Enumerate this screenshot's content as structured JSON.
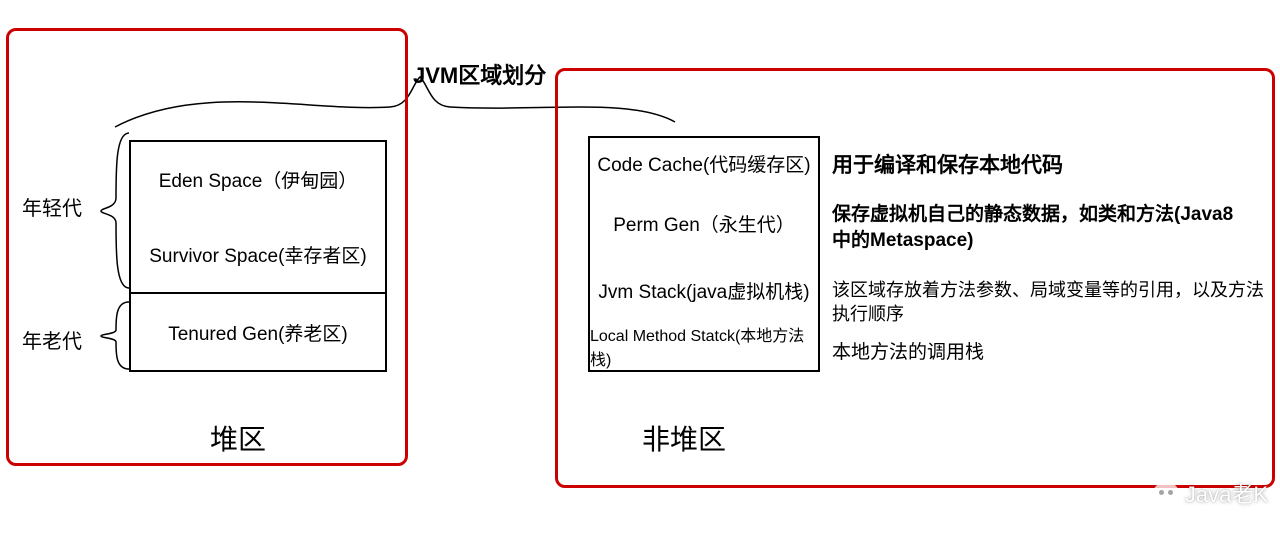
{
  "title": "JVM区域划分",
  "heap": {
    "young_label": "年轻代",
    "old_label": "年老代",
    "eden": "Eden Space（伊甸园）",
    "survivor": "Survivor Space(幸存者区)",
    "tenured": "Tenured Gen(养老区)",
    "caption": "堆区"
  },
  "nonheap": {
    "code_cache": "Code Cache(代码缓存区)",
    "perm_gen": "Perm Gen（永生代）",
    "jvm_stack": "Jvm Stack(java虚拟机栈)",
    "local_stack": "Local Method Statck(本地方法栈)",
    "caption": "非堆区"
  },
  "desc": {
    "d1": "用于编译和保存本地代码",
    "d2": "保存虚拟机自己的静态数据，如类和方法(Java8中的Metaspace)",
    "d3": "该区域存放着方法参数、局域变量等的引用，以及方法执行顺序",
    "d4": "本地方法的调用栈"
  },
  "watermark": "Java老K"
}
